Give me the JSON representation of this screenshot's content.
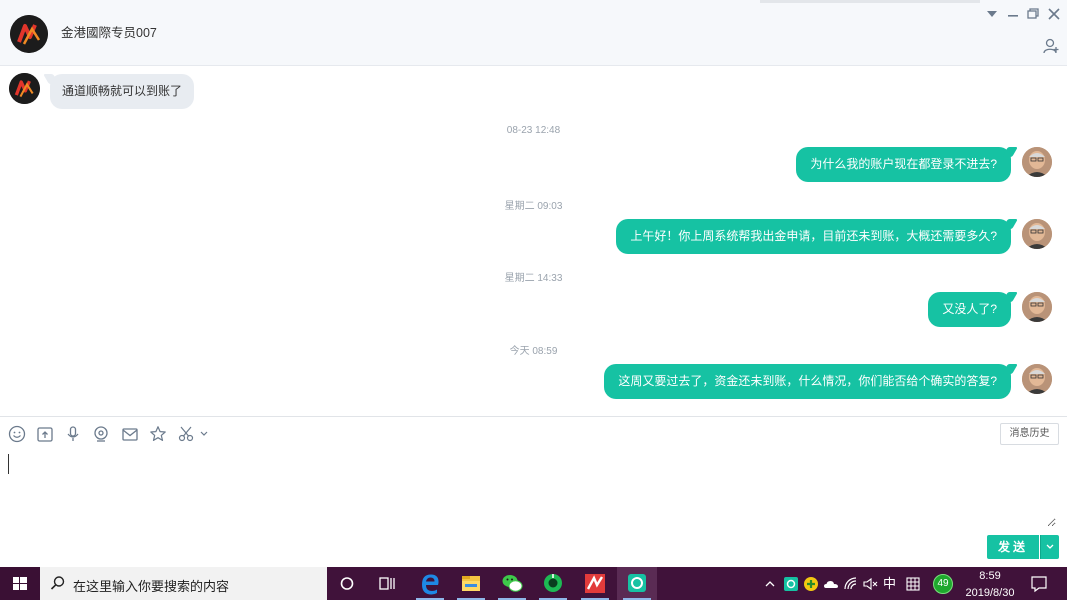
{
  "header": {
    "title": "金港國際专员007"
  },
  "messages": [
    {
      "side": "left",
      "text": "通道顺畅就可以到账了"
    },
    {
      "side": "time",
      "text": "08-23 12:48"
    },
    {
      "side": "right",
      "text": "为什么我的账户现在都登录不进去?"
    },
    {
      "side": "time",
      "text": "星期二 09:03"
    },
    {
      "side": "right",
      "text": "上午好！你上周系统帮我出金申请，目前还未到账，大概还需要多久?"
    },
    {
      "side": "time",
      "text": "星期二 14:33"
    },
    {
      "side": "right",
      "text": "又没人了?"
    },
    {
      "side": "time",
      "text": "今天 08:59"
    },
    {
      "side": "right",
      "text": "这周又要过去了，资金还未到账，什么情况，你们能否给个确实的答复?"
    }
  ],
  "toolbar": {
    "history_label": "消息历史"
  },
  "composer": {
    "send_label": "发送"
  },
  "taskbar": {
    "search_placeholder": "在这里输入你要搜索的内容",
    "ime_label": "中",
    "badge_count": "49",
    "time": "8:59",
    "date": "2019/8/30"
  },
  "colors": {
    "accent": "#16c2a3",
    "taskbar": "#40123a",
    "bubble_left": "#e8ecf1"
  }
}
